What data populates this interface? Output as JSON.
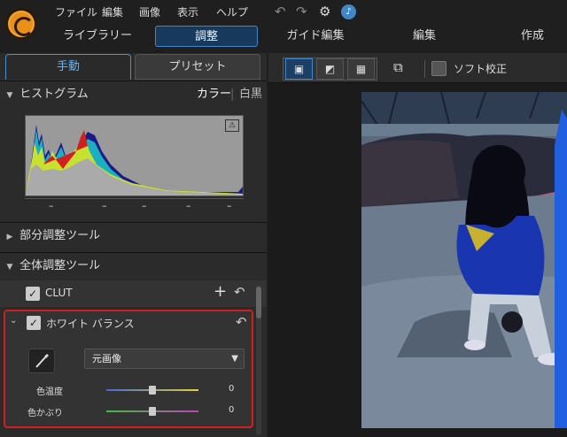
{
  "menu": [
    "ファイル",
    "編集",
    "画像",
    "表示",
    "ヘルプ"
  ],
  "nav_tabs": [
    "ライブラリー",
    "調整",
    "ガイド編集",
    "編集",
    "作成"
  ],
  "panel_tabs": {
    "manual": "手動",
    "preset": "プリセット"
  },
  "histogram": {
    "title": "ヒストグラム",
    "color_mode": "カラー",
    "mono_mode": "白黒",
    "readouts": [
      "–",
      "–",
      "–",
      "–",
      "–"
    ]
  },
  "sections": {
    "partial": "部分調整ツール",
    "global": "全体調整ツール"
  },
  "clut": {
    "label": "CLUT"
  },
  "white_balance": {
    "label": "ホワイト バランス",
    "preset_value": "元画像",
    "temperature": {
      "label": "色温度",
      "value": "0",
      "level": 0.5
    },
    "tint": {
      "label": "色かぶり",
      "value": "0",
      "level": 0.5
    }
  },
  "view_toolbar": {
    "soft_proof": "ソフト校正"
  },
  "colors": {
    "accent": "#3f87c9",
    "highlight_border": "#d12020",
    "active_tab_text": "#6fb2ea"
  },
  "icons": [
    "app-logo-icon",
    "undo-icon",
    "redo-icon",
    "gear-icon",
    "notification-icon",
    "cursor-icon",
    "histogram-warning-icon",
    "eyedropper-icon",
    "plus-icon",
    "reset-icon",
    "chevron-down-icon",
    "dropdown-arrow-icon",
    "single-view-icon",
    "compare-view-icon",
    "grid-view-icon",
    "fit-screen-icon"
  ]
}
